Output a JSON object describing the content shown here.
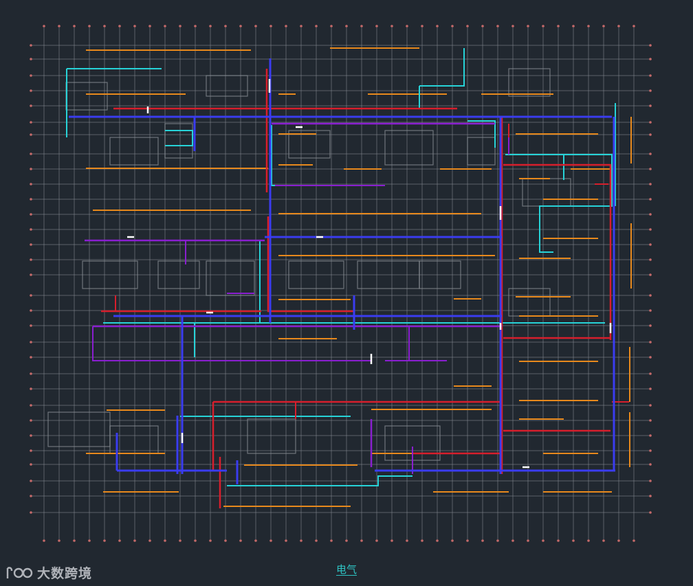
{
  "drawing": {
    "caption": "电气",
    "watermark": {
      "text": "大数跨境"
    },
    "colors": {
      "background": "#212830",
      "grid": "#8a8f96",
      "axis_marker": "#c56a6a",
      "orange": "#e8891c",
      "cyan": "#27d3d8",
      "red": "#d81e2c",
      "purple": "#8a1fd0",
      "blue": "#3a3cf0",
      "white": "#ffffff"
    }
  }
}
